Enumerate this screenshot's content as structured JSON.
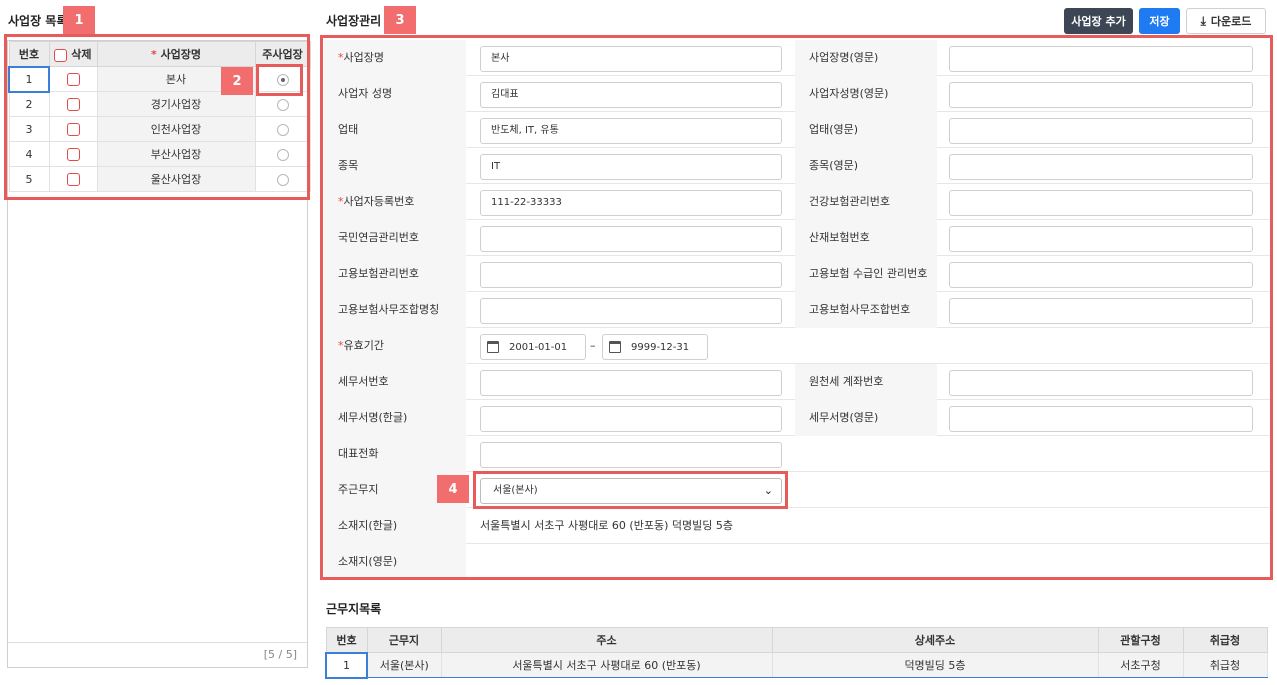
{
  "left": {
    "title": "사업장 목록",
    "columns": {
      "num": "번호",
      "delete": "삭제",
      "name": "사업장명",
      "name_required": "*",
      "main": "주사업장"
    },
    "rows": [
      {
        "num": "1",
        "name": "본사",
        "main": true
      },
      {
        "num": "2",
        "name": "경기사업장",
        "main": false
      },
      {
        "num": "3",
        "name": "인천사업장",
        "main": false
      },
      {
        "num": "4",
        "name": "부산사업장",
        "main": false
      },
      {
        "num": "5",
        "name": "울산사업장",
        "main": false
      }
    ],
    "pager": "[5 / 5]"
  },
  "markers": {
    "m1": "1",
    "m2": "2",
    "m3": "3",
    "m4": "4"
  },
  "main": {
    "title": "사업장관리",
    "buttons": {
      "add": "사업장 추가",
      "save": "저장",
      "download": "다운로드"
    },
    "required_mark": "*",
    "fields": {
      "biz_name": {
        "label": "사업장명",
        "value": "본사"
      },
      "biz_name_en": {
        "label": "사업장명(영문)",
        "value": ""
      },
      "ceo": {
        "label": "사업자 성명",
        "value": "김대표"
      },
      "ceo_en": {
        "label": "사업자성명(영문)",
        "value": ""
      },
      "biz_type": {
        "label": "업태",
        "value": "반도체, IT, 유통"
      },
      "biz_type_en": {
        "label": "업태(영문)",
        "value": ""
      },
      "item": {
        "label": "종목",
        "value": "IT"
      },
      "item_en": {
        "label": "종목(영문)",
        "value": ""
      },
      "reg_no": {
        "label": "사업자등록번호",
        "value": "111-22-33333"
      },
      "health_no": {
        "label": "건강보험관리번호",
        "value": ""
      },
      "pension_no": {
        "label": "국민연금관리번호",
        "value": ""
      },
      "accident_no": {
        "label": "산재보험번호",
        "value": ""
      },
      "employ_no": {
        "label": "고용보험관리번호",
        "value": ""
      },
      "employ_recv_no": {
        "label": "고용보험 수급인 관리번호",
        "value": ""
      },
      "employ_office_name": {
        "label": "고용보험사무조합명칭",
        "value": ""
      },
      "employ_office_no": {
        "label": "고용보험사무조합번호",
        "value": ""
      },
      "valid_period": {
        "label": "유효기간",
        "start": "2001-01-01",
        "sep": "–",
        "end": "9999-12-31"
      },
      "tax_office_no": {
        "label": "세무서번호",
        "value": ""
      },
      "withholding_acct": {
        "label": "원천세 계좌번호",
        "value": ""
      },
      "tax_office_ko": {
        "label": "세무서명(한글)",
        "value": ""
      },
      "tax_office_en": {
        "label": "세무서명(영문)",
        "value": ""
      },
      "phone": {
        "label": "대표전화",
        "value": ""
      },
      "main_workplace": {
        "label": "주근무지",
        "selected": "서울(본사)"
      },
      "address_ko": {
        "label": "소재지(한글)",
        "value": "서울특별시 서초구 사평대로 60 (반포동) 덕명빌딩 5층"
      },
      "address_en": {
        "label": "소재지(영문)",
        "value": ""
      }
    }
  },
  "workplaces": {
    "title": "근무지목록",
    "columns": [
      "번호",
      "근무지",
      "주소",
      "상세주소",
      "관할구청",
      "취급청"
    ],
    "rows": [
      {
        "num": "1",
        "name": "서울(본사)",
        "address": "서울특별시 서초구 사평대로 60 (반포동)",
        "detail": "덕명빌딩 5층",
        "district": "서초구청",
        "office": "취급청"
      }
    ]
  }
}
